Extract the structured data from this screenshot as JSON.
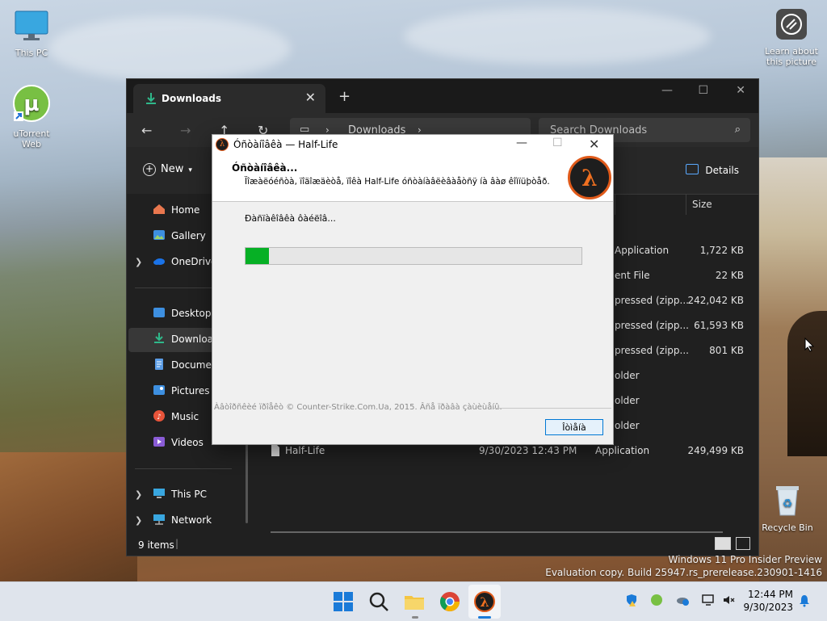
{
  "desktop": {
    "icons": [
      {
        "label": "This PC"
      },
      {
        "label": "uTorrent Web"
      },
      {
        "label": "Learn about this picture"
      },
      {
        "label": "Recycle Bin"
      }
    ]
  },
  "explorer": {
    "tab_title": "Downloads",
    "breadcrumb": [
      "Downloads"
    ],
    "search_placeholder": "Search Downloads",
    "new_label": "New",
    "details_label": "Details",
    "column_size": "Size",
    "sidebar": [
      {
        "label": "Home"
      },
      {
        "label": "Gallery"
      },
      {
        "label": "OneDrive"
      },
      {
        "label": "Desktop"
      },
      {
        "label": "Downloads"
      },
      {
        "label": "Documents"
      },
      {
        "label": "Pictures"
      },
      {
        "label": "Music"
      },
      {
        "label": "Videos"
      },
      {
        "label": "This PC"
      },
      {
        "label": "Network"
      }
    ],
    "rows": [
      {
        "type": "Application",
        "size": "1,722 KB"
      },
      {
        "type": "ent File",
        "size": "22 KB"
      },
      {
        "type": "pressed (zipp...",
        "size": "242,042 KB"
      },
      {
        "type": "pressed (zipp...",
        "size": "61,593 KB"
      },
      {
        "type": "pressed (zipp...",
        "size": "801 KB"
      },
      {
        "type": "older",
        "size": ""
      },
      {
        "type": "older",
        "size": ""
      },
      {
        "type": "older",
        "size": ""
      },
      {
        "name": "Half-Life",
        "date": "9/30/2023 12:43 PM",
        "type": "Application",
        "size": "249,499 KB"
      }
    ],
    "status": "9 items"
  },
  "installer": {
    "title": "Óñòàíîâêà — Half-Life",
    "header": "Óñòàíîâêà...",
    "subheader": "Ïîæàëóéñòà, ïîäîæäèòå, ïîêà Half-Life óñòàíàâëèâàåòñÿ íà âàø êîìïüþòåð.",
    "status": "Ðàñïàêîâêà ôàéëîâ...",
    "progress": 0.07,
    "branding": "Àâòîðñêèé ïðîåêò © Counter-Strike.Com.Ua, 2015. Âñå ïðàâà çàùèùåíû.",
    "cancel_label": "Îòìåíà",
    "logo_glyph": "λ"
  },
  "watermark": {
    "line1": "Windows 11 Pro Insider Preview",
    "line2": "Evaluation copy. Build 25947.rs_prerelease.230901-1416"
  },
  "taskbar": {
    "time": "12:44 PM",
    "date": "9/30/2023"
  },
  "colors": {
    "accent": "#0078d4",
    "progress": "#06b025",
    "hl_orange": "#e05a1a"
  }
}
